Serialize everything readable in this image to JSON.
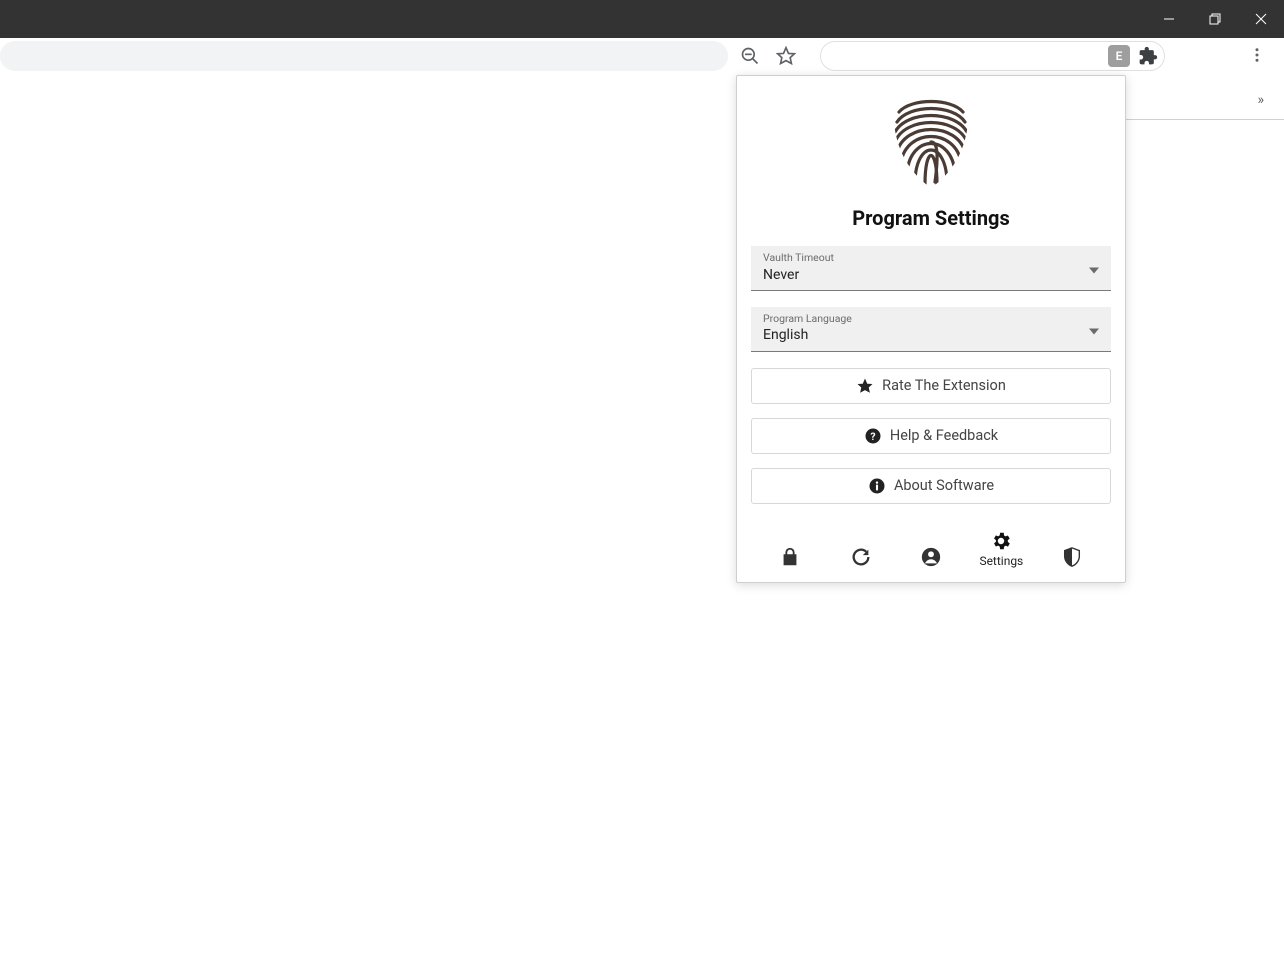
{
  "window": {
    "minimize": "Minimize",
    "maximize": "Maximize",
    "close": "Close"
  },
  "toolbar": {
    "extension_badge": "E",
    "overflow": "»"
  },
  "popup": {
    "title": "Program Settings",
    "vault_timeout": {
      "label": "Vaulth Timeout",
      "value": "Never"
    },
    "language": {
      "label": "Program Language",
      "value": "English"
    },
    "actions": {
      "rate": "Rate The Extension",
      "help": "Help & Feedback",
      "about": "About Software"
    },
    "nav": {
      "lock": "",
      "refresh": "",
      "account": "",
      "settings": "Settings",
      "shield": ""
    }
  }
}
